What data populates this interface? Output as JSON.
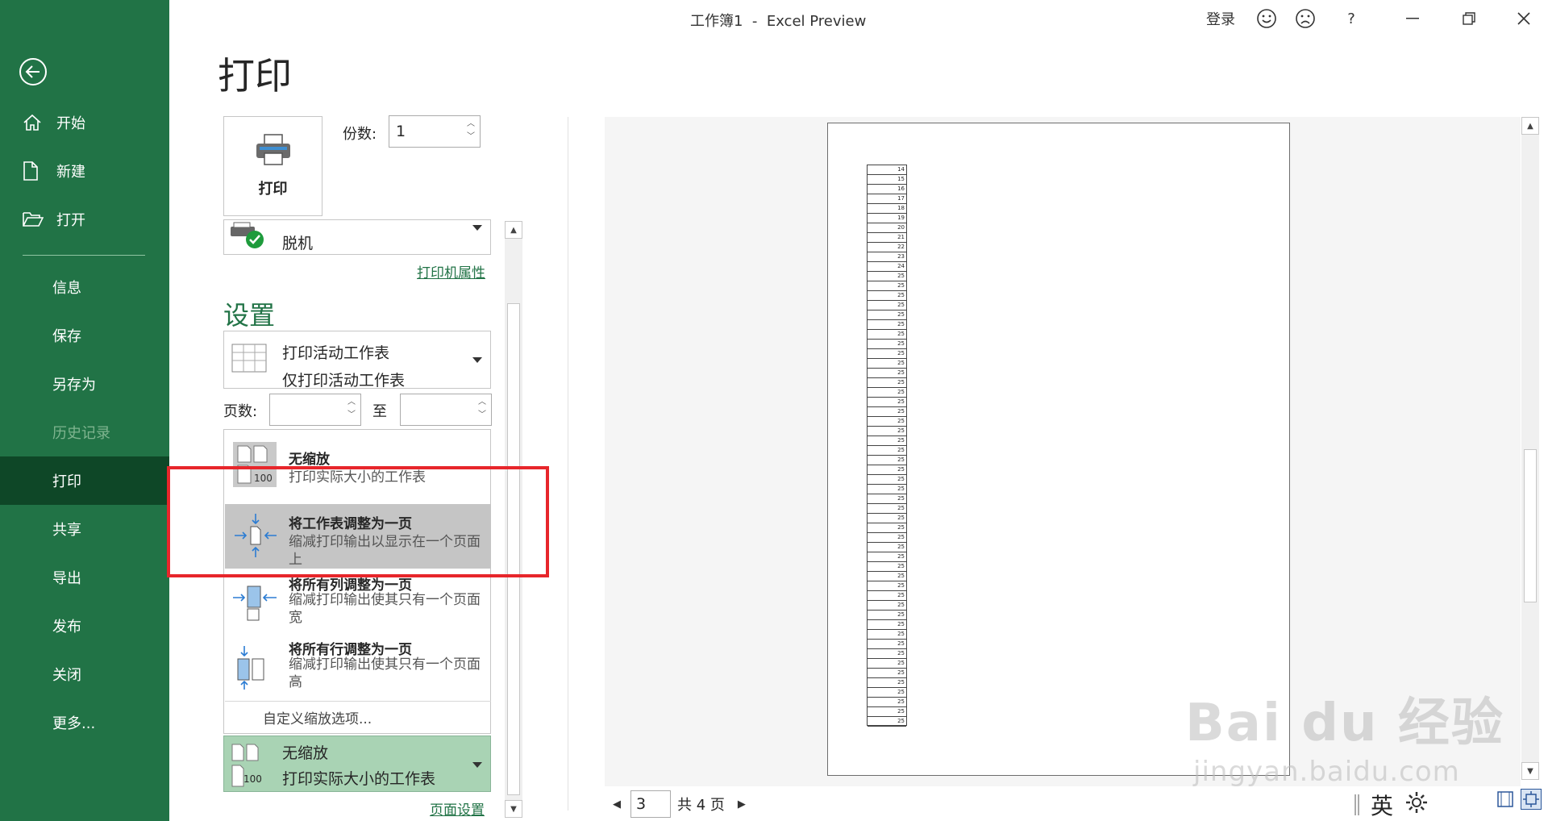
{
  "window": {
    "title": "工作簿1  -  Excel Preview",
    "signin": "登录",
    "help": "?"
  },
  "sidebar": {
    "items": [
      {
        "label": "开始"
      },
      {
        "label": "新建"
      },
      {
        "label": "打开"
      },
      {
        "label": "信息"
      },
      {
        "label": "保存"
      },
      {
        "label": "另存为"
      },
      {
        "label": "历史记录"
      },
      {
        "label": "打印"
      },
      {
        "label": "共享"
      },
      {
        "label": "导出"
      },
      {
        "label": "发布"
      },
      {
        "label": "关闭"
      },
      {
        "label": "更多..."
      }
    ],
    "active": "打印",
    "disabled": "历史记录",
    "accent_color": "#217346"
  },
  "print": {
    "heading": "打印",
    "print_button": "打印",
    "copies_label": "份数:",
    "copies_value": "1",
    "printer_name": "脱机",
    "printer_properties": "打印机属性",
    "settings_heading": "设置",
    "what_to_print": {
      "title": "打印活动工作表",
      "desc": "仅打印活动工作表"
    },
    "pages_label": "页数:",
    "pages_to": "至",
    "scaling_options": [
      {
        "title": "无缩放",
        "desc": "打印实际大小的工作表",
        "icon": "no-scaling-icon"
      },
      {
        "title": "将工作表调整为一页",
        "desc": "缩减打印输出以显示在一个页面上",
        "icon": "fit-sheet-icon"
      },
      {
        "title": "将所有列调整为一页",
        "desc": "缩减打印输出使其只有一个页面宽",
        "icon": "fit-columns-icon"
      },
      {
        "title": "将所有行调整为一页",
        "desc": "缩减打印输出使其只有一个页面高",
        "icon": "fit-rows-icon"
      }
    ],
    "scaling_custom": "自定义缩放选项...",
    "scaling_current": {
      "title": "无缩放",
      "desc": "打印实际大小的工作表",
      "badge": "100"
    },
    "page_setup": "页面设置",
    "highlight_color": "#e7262b"
  },
  "preview": {
    "current_page": "3",
    "total_pages": "共 4 页",
    "row_numbers": [
      "14",
      "15",
      "16",
      "17",
      "18",
      "19",
      "20",
      "21",
      "22",
      "23",
      "24",
      "25",
      "25",
      "25",
      "25",
      "25",
      "25",
      "25",
      "25",
      "25",
      "25",
      "25",
      "25",
      "25",
      "25",
      "25",
      "25",
      "25",
      "25",
      "25",
      "25",
      "25",
      "25",
      "25",
      "25",
      "25",
      "25",
      "25",
      "25",
      "25",
      "25",
      "25",
      "25",
      "25",
      "25",
      "25",
      "25",
      "25",
      "25",
      "25",
      "25",
      "25",
      "25",
      "25",
      "25",
      "25",
      "25",
      "25"
    ]
  },
  "taskbar": {
    "ime": "英"
  },
  "watermark": {
    "brand": "Bai du 经验",
    "url": "jingyan.baidu.com"
  }
}
